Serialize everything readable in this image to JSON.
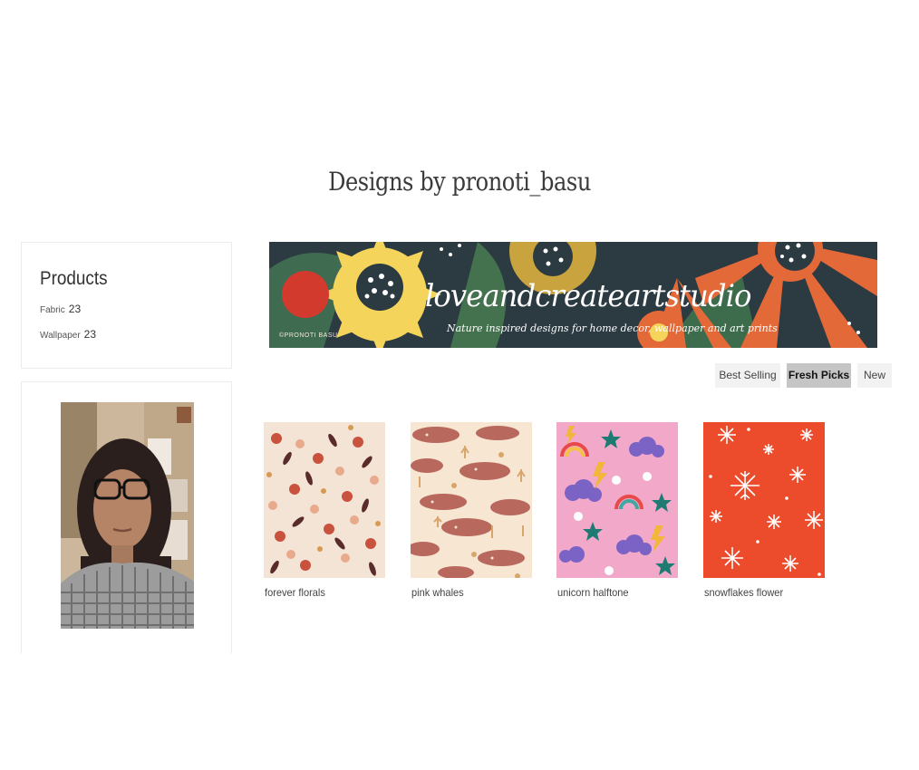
{
  "page": {
    "title": "Designs by pronoti_basu"
  },
  "products": {
    "title": "Products",
    "items": [
      {
        "label": "Fabric",
        "count": "23"
      },
      {
        "label": "Wallpaper",
        "count": "23"
      }
    ]
  },
  "banner": {
    "shop_name": "loveandcreateartstudio",
    "tagline": "Nature inspired designs for home decor, wallpaper and art prints",
    "credit": "©PRONOTI BASU",
    "colors": {
      "background": "#2c3a42",
      "yellow": "#f4d45a",
      "orange": "#e36a38",
      "mustard": "#c9a43e",
      "green": "#4e8a5c"
    }
  },
  "sort_options": [
    {
      "label": "Best Selling",
      "selected": false
    },
    {
      "label": "Fresh Picks",
      "selected": true
    },
    {
      "label": "New",
      "selected": false
    }
  ],
  "designs": [
    {
      "title": "forever florals"
    },
    {
      "title": "pink whales"
    },
    {
      "title": "unicorn halftone"
    },
    {
      "title": "snowflakes flower"
    }
  ]
}
